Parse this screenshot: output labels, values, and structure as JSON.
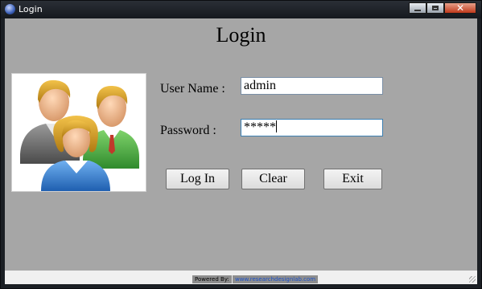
{
  "window": {
    "title": "Login",
    "controls": {
      "minimize": "minimize",
      "maximize": "maximize",
      "close": "✕"
    }
  },
  "form": {
    "title": "Login",
    "image_icon": "users-group-icon",
    "username_label": "User Name :",
    "username_value": "admin",
    "password_label": "Password :",
    "password_value": "*****",
    "buttons": {
      "login": "Log In",
      "clear": "Clear",
      "exit": "Exit"
    }
  },
  "status": {
    "powered_by": "Powered By:",
    "site": "www.researchdesignlab.com"
  },
  "colors": {
    "form_background": "#a6a6a6",
    "titlebar": "#1b1f24",
    "close_button": "#c0391b",
    "link": "#1e52c8"
  }
}
